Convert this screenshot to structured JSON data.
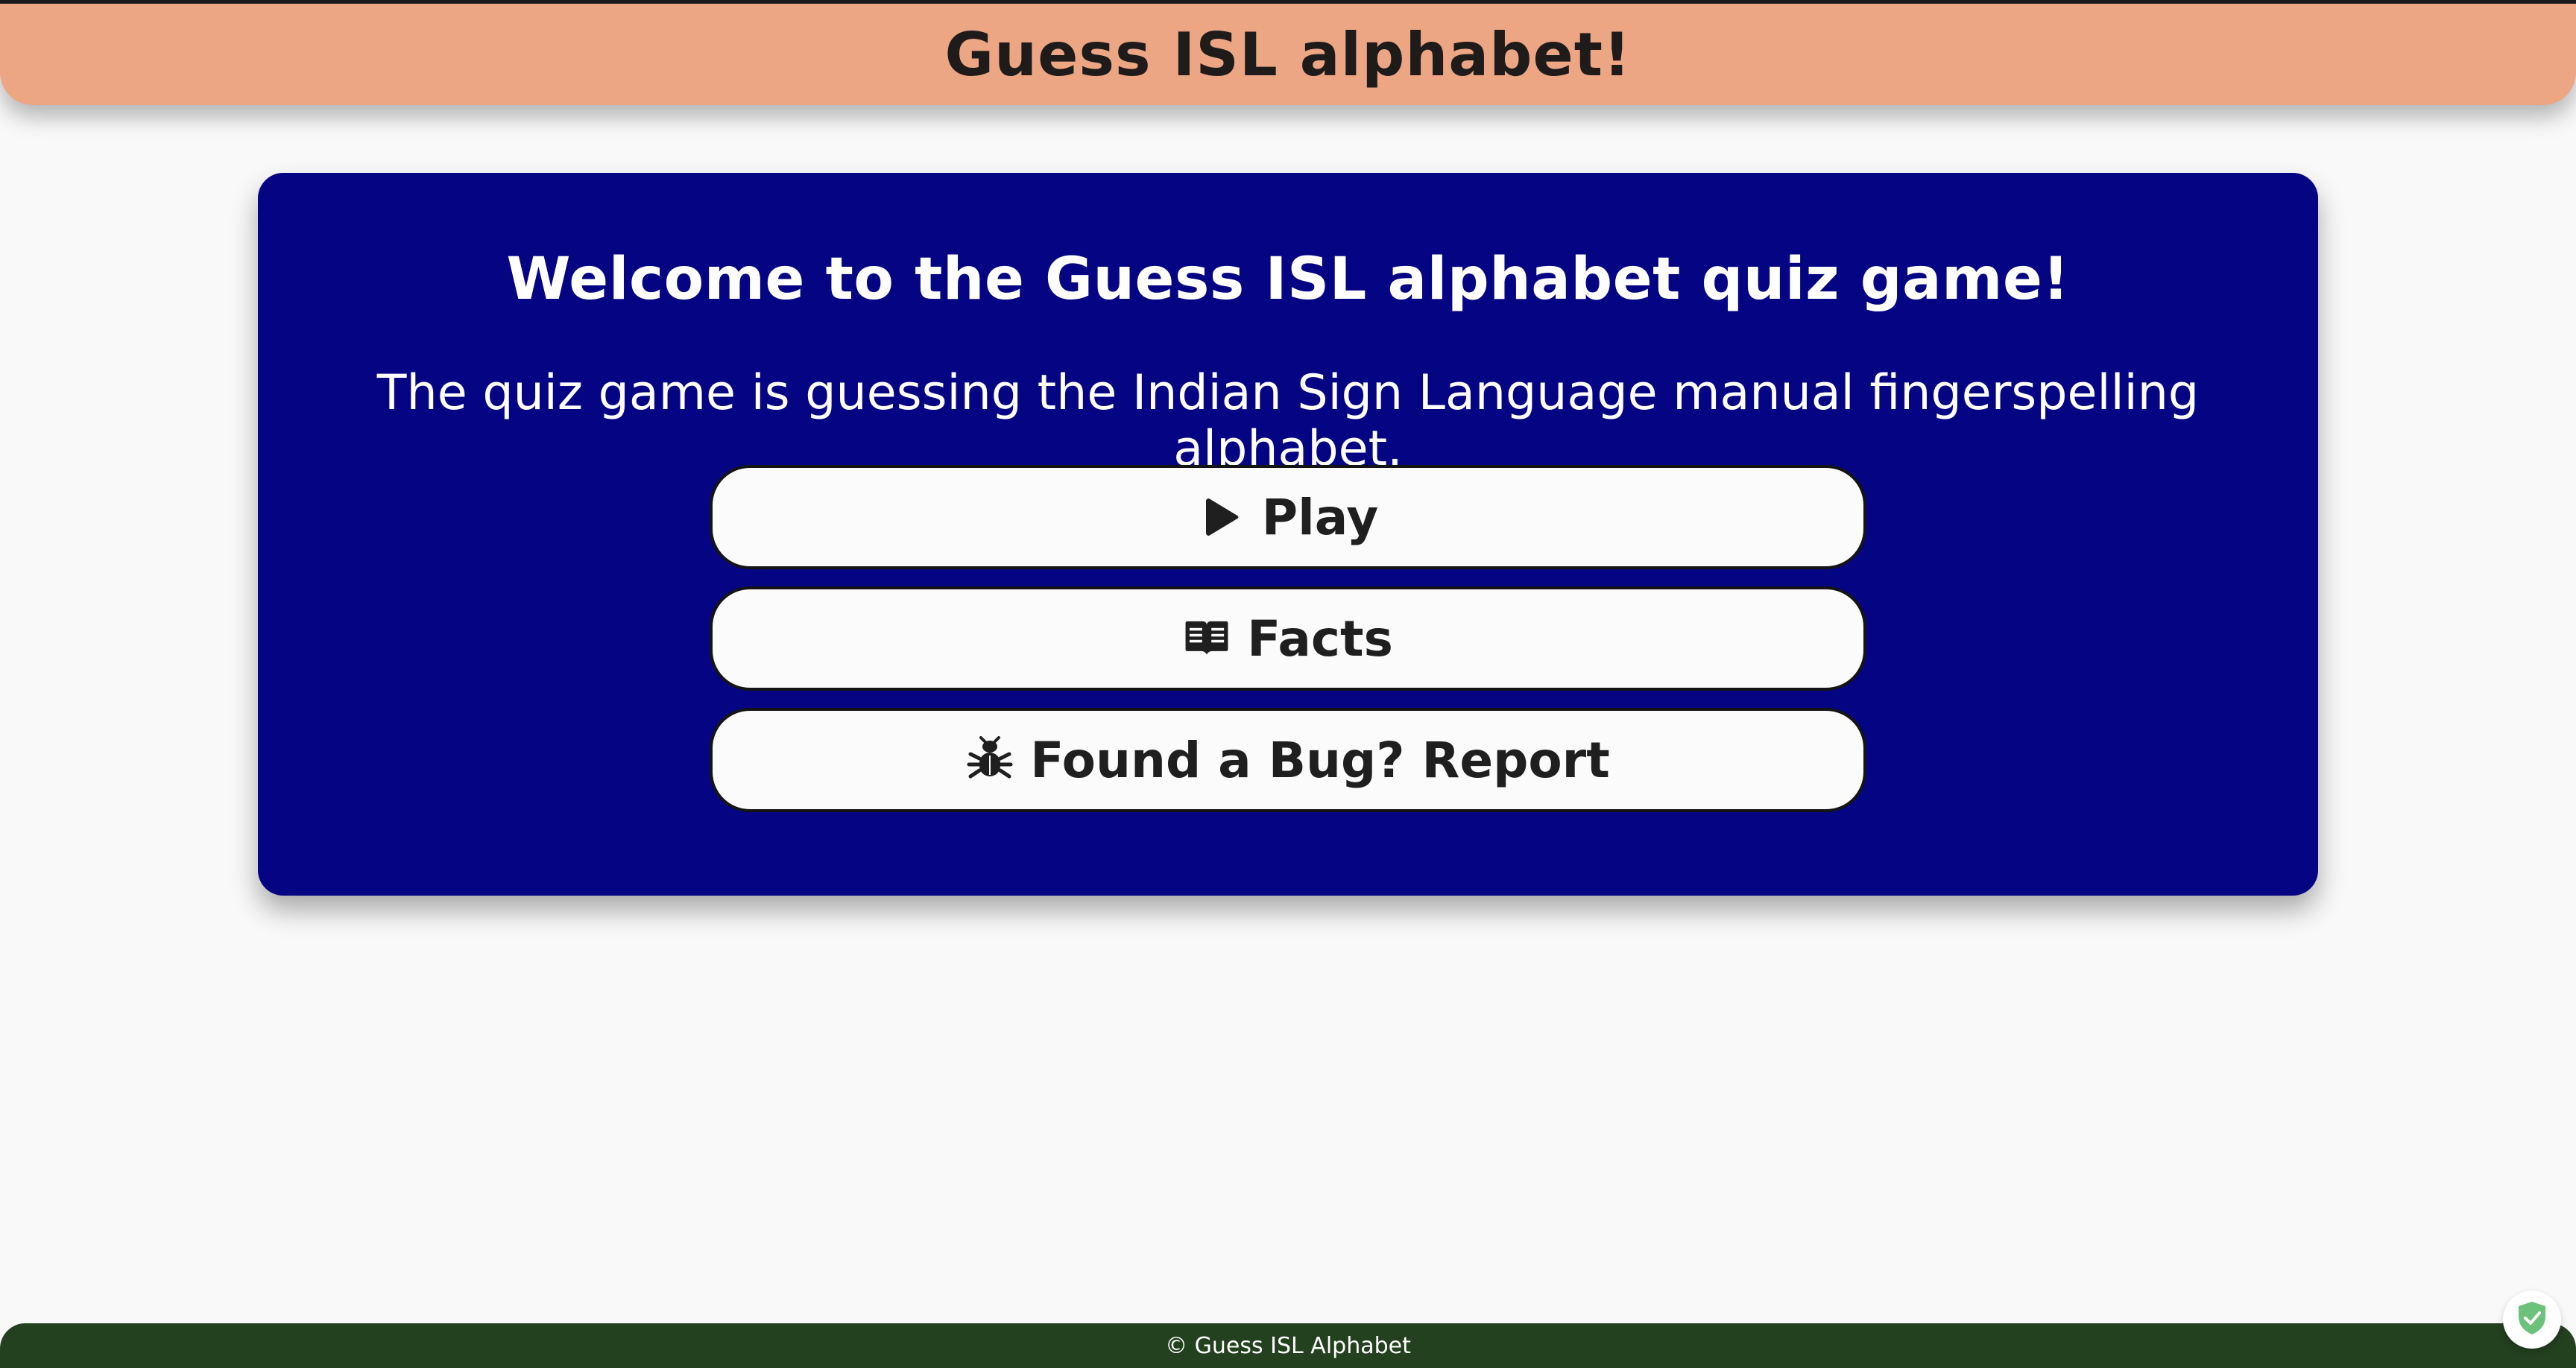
{
  "header": {
    "title": "Guess ISL alphabet!"
  },
  "main": {
    "heading": "Welcome to the Guess ISL alphabet quiz game!",
    "description": "The quiz game is guessing the Indian Sign Language manual fingerspelling alphabet.",
    "buttons": [
      {
        "label": "Play",
        "icon": "play-icon"
      },
      {
        "label": "Facts",
        "icon": "book-icon"
      },
      {
        "label": "Found a Bug? Report",
        "icon": "bug-icon"
      }
    ]
  },
  "footer": {
    "text": "© Guess ISL Alphabet"
  },
  "colors": {
    "header_bg": "#eca684",
    "card_bg": "#050584",
    "footer_bg": "#23401f",
    "page_bg": "#f9f9f9"
  },
  "floating_badge": {
    "icon": "shield-check-icon"
  }
}
